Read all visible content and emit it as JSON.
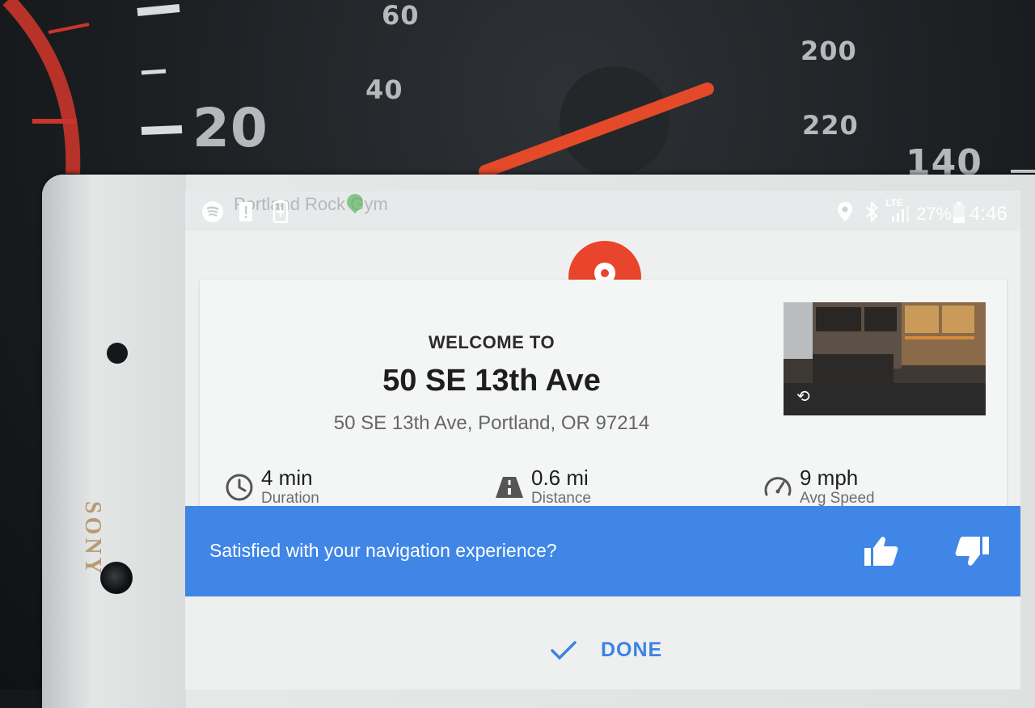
{
  "dashboard": {
    "speedometer_numbers": [
      "60",
      "40",
      "20"
    ],
    "tachometer_numbers": [
      "200",
      "220",
      "140"
    ],
    "phone_brand": "SONY"
  },
  "statusbar": {
    "map_label": "Portland Rock Gym",
    "network_label": "LTE",
    "battery": "27%",
    "time": "4:46",
    "icons": [
      "spotify-icon",
      "alert-icon",
      "battery-saver-icon",
      "location-icon",
      "bluetooth-icon",
      "signal-icon",
      "battery-icon"
    ]
  },
  "arrival_card": {
    "welcome": "WELCOME TO",
    "title": "50 SE 13th Ave",
    "address": "50 SE 13th Ave, Portland, OR 97214",
    "pin_color": "#e8452c",
    "stats": [
      {
        "value": "4 min",
        "label": "Duration",
        "icon": "clock-icon"
      },
      {
        "value": "0.6 mi",
        "label": "Distance",
        "icon": "road-icon"
      },
      {
        "value": "9 mph",
        "label": "Avg Speed",
        "icon": "speedometer-icon"
      }
    ]
  },
  "feedback": {
    "question": "Satisfied with your navigation experience?",
    "color": "#3f86e6"
  },
  "footer": {
    "done_label": "DONE",
    "accent": "#3d82e3"
  }
}
